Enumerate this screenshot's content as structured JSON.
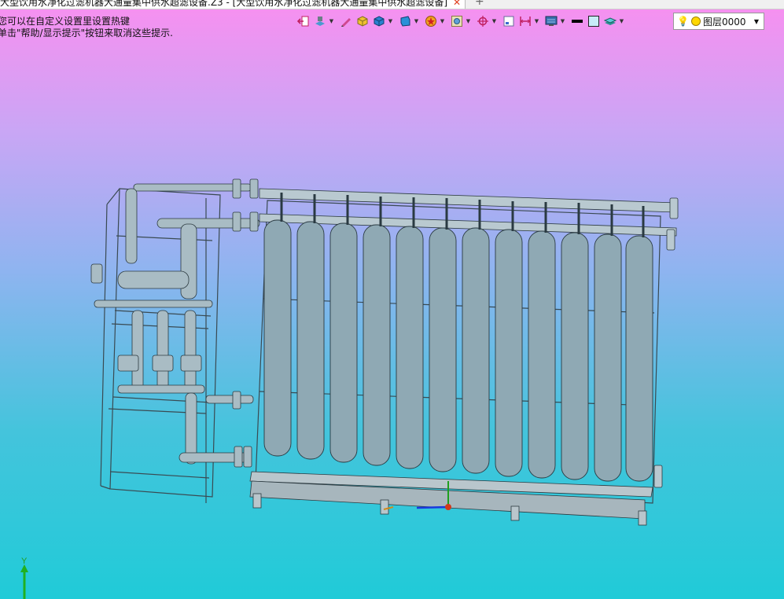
{
  "window": {
    "tab_title": "大型饮用水净化过滤机器大通量集中供水超滤设备.Z3 - [大型饮用水净化过滤机器大通量集中供水超滤设备]",
    "close_glyph": "✕",
    "new_tab_glyph": "+"
  },
  "hints": {
    "line1": "您可以在自定义设置里设置热键",
    "line2": "单击\"帮助/显示提示\"按钮来取消这些提示."
  },
  "toolbar": {
    "icons": [
      "exit-icon",
      "view-cube-icon",
      "pen-icon",
      "shade-box-icon",
      "solid-box-icon",
      "iso-box-icon",
      "star-filter-icon",
      "view-frame-icon",
      "pick-icon",
      "small-square-icon",
      "dimension-icon",
      "monitor-icon",
      "line-color-icon",
      "fill-color-icon",
      "layers-icon"
    ]
  },
  "layer_selector": {
    "value": "图层0000",
    "colors": {
      "dot": "#ffd700"
    }
  },
  "viewport": {
    "colors": {
      "background_top": "#f98ff0",
      "background_bottom": "#20cbd8",
      "part": "#8fa9b4"
    },
    "axis_label": "Y"
  }
}
